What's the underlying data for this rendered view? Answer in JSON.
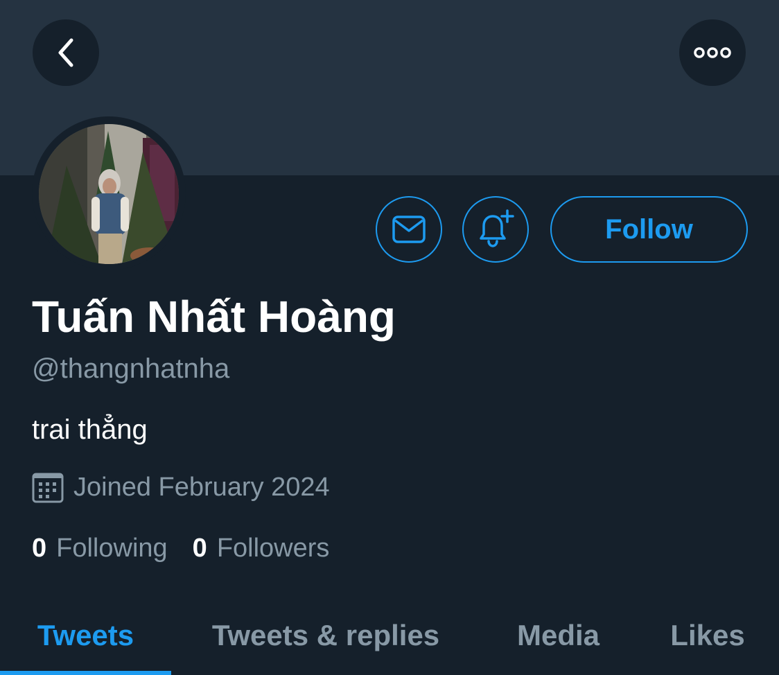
{
  "header": {
    "back_icon": "chevron-left-icon",
    "more_icon": "more-horizontal-icon"
  },
  "profile": {
    "name": "Tuấn Nhất Hoàng",
    "handle": "@thangnhatnha",
    "bio": "trai thẳng",
    "joined": "Joined February 2024",
    "following_count": "0",
    "following_label": "Following",
    "followers_count": "0",
    "followers_label": "Followers"
  },
  "actions": {
    "message_icon": "mail-icon",
    "notify_icon": "bell-plus-icon",
    "follow_label": "Follow"
  },
  "tabs": [
    {
      "label": "Tweets",
      "active": true
    },
    {
      "label": "Tweets & replies",
      "active": false
    },
    {
      "label": "Media",
      "active": false
    },
    {
      "label": "Likes",
      "active": false
    }
  ],
  "colors": {
    "background": "#15202b",
    "banner": "#253341",
    "accent": "#1d9bf0",
    "secondary_text": "#8899a6"
  }
}
